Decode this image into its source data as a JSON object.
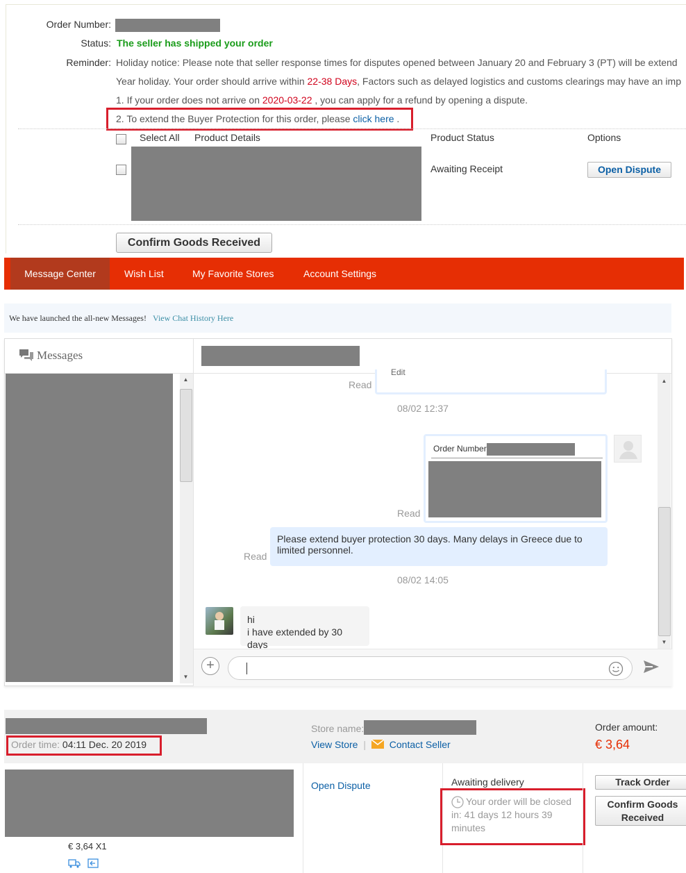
{
  "order_detail": {
    "order_number_label": "Order Number:",
    "status_label": "Status:",
    "status_value": "The seller has shipped your order",
    "reminder_label": "Reminder:",
    "holiday_line": "Holiday notice: Please note that seller response times for disputes opened between January 20 and February 3 (PT) will be extend",
    "arrive_prefix": "Year holiday. Your order should arrive within ",
    "arrive_days": "22-38 Days",
    "arrive_suffix": ", Factors such as delayed logistics and customs clearings may have an imp",
    "refund_prefix": "1. If your order does not arrive on ",
    "refund_date": "2020-03-22",
    "refund_suffix": " , you can apply for a refund by opening a dispute.",
    "extend_prefix": "2. To extend the Buyer Protection for this order, please ",
    "extend_link": "click here",
    "extend_suffix": " .",
    "col_select_all": "Select All",
    "col_product_details": "Product Details",
    "col_product_status": "Product Status",
    "col_options": "Options",
    "product_status": "Awaiting Receipt",
    "open_dispute": "Open Dispute",
    "confirm_goods": "Confirm Goods Received"
  },
  "nav": {
    "tabs": [
      "Message Center",
      "Wish List",
      "My Favorite Stores",
      "Account Settings"
    ],
    "active": "Message Center"
  },
  "notice": {
    "text": "We have launched the all-new Messages!",
    "link": "View Chat History Here"
  },
  "messages": {
    "title": "Messages",
    "top_fragment": "Edit",
    "read_label": "Read",
    "ts1": "08/02 12:37",
    "order_card_label": "Order Number",
    "msg_me": "Please extend buyer protection 30 days. Many delays in Greece due to limited personnel.",
    "ts2": "08/02 14:05",
    "reply_line1": "hi",
    "reply_line2": "i have extended by 30 days"
  },
  "order_list": {
    "order_time_label": "Order time:",
    "order_time_value": "04:11 Dec. 20 2019",
    "store_name_label": "Store name:",
    "view_store": "View Store",
    "separator": "|",
    "contact_seller": "Contact Seller",
    "order_amount_label": "Order amount:",
    "order_amount_value": "€ 3,64",
    "open_dispute": "Open Dispute",
    "delivery_status": "Awaiting delivery",
    "closing_text": "Your order will be closed in: 41 days 12 hours 39 minutes",
    "track_order": "Track Order",
    "confirm_goods_line1": "Confirm Goods",
    "confirm_goods_line2": "Received",
    "price_qty": "€ 3,64 X1"
  },
  "colors": {
    "brand_red": "#e62e04",
    "nav_active": "#b23a1d",
    "highlight_box": "#d81e2c",
    "status_green": "#1a9c1a",
    "link_blue": "#0b5fa5",
    "accent_red": "#d0021b"
  }
}
